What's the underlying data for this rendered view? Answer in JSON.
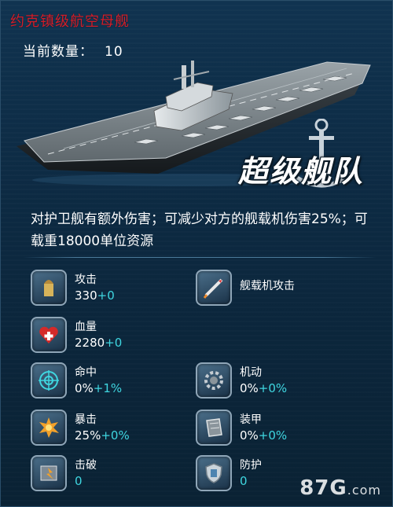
{
  "header": {
    "title": "约克镇级航空母舰",
    "count_label": "当前数量：",
    "count_value": "10"
  },
  "logo": {
    "text": "超级舰队"
  },
  "description": "对护卫舰有额外伤害；可减少对方的舰载机伤害25%；可载重18000单位资源",
  "stats": [
    {
      "name": "攻击",
      "base": "330",
      "bonus": "+0",
      "icon": "bullet-icon"
    },
    {
      "name": "舰载机攻击",
      "base": "",
      "bonus": "",
      "icon": "missile-icon"
    },
    {
      "name": "血量",
      "base": "2280",
      "bonus": "+0",
      "icon": "heart-icon"
    },
    {
      "name": "命中",
      "base": "0%",
      "bonus": "+1%",
      "icon": "target-icon"
    },
    {
      "name": "机动",
      "base": "0%",
      "bonus": "+0%",
      "icon": "gear-icon"
    },
    {
      "name": "暴击",
      "base": "25%",
      "bonus": "+0%",
      "icon": "explosion-icon"
    },
    {
      "name": "装甲",
      "base": "0%",
      "bonus": "+0%",
      "icon": "armor-icon"
    },
    {
      "name": "击破",
      "base": "0",
      "bonus": "",
      "icon": "break-icon"
    },
    {
      "name": "防护",
      "base": "0",
      "bonus": "",
      "icon": "shield-icon"
    }
  ],
  "watermark": {
    "main": "87G",
    "suffix": ".com"
  },
  "colors": {
    "title": "#d21e2a",
    "bonus": "#3fd6e0",
    "background": "#0e2a40"
  }
}
